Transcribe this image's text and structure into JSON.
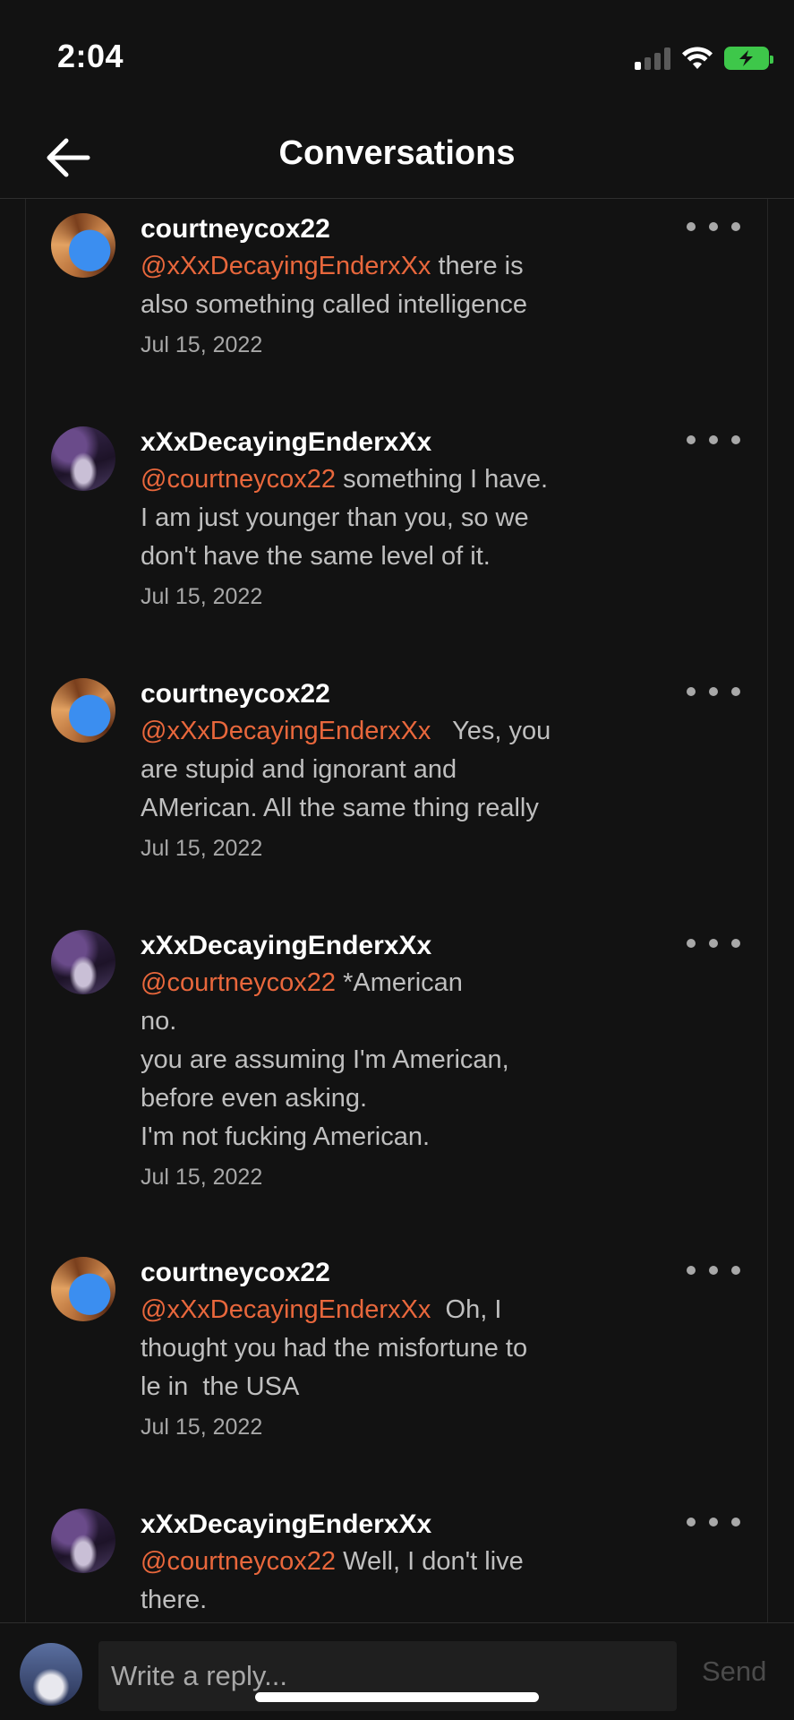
{
  "status_bar": {
    "time": "2:04"
  },
  "header": {
    "title": "Conversations"
  },
  "comments": [
    {
      "author": "courtneycox22",
      "mention": "@xXxDecayingEnderxXx",
      "text": " there is\nalso something called intelligence",
      "date": "Jul 15, 2022"
    },
    {
      "author": "xXxDecayingEnderxXx",
      "mention": "@courtneycox22",
      "text": " something I have.\nI am just younger than you, so we\ndon't have the same level of it.",
      "date": "Jul 15, 2022"
    },
    {
      "author": "courtneycox22",
      "mention": "@xXxDecayingEnderxXx",
      "text": "   Yes, you\nare stupid and ignorant and\nAMerican. All the same thing really",
      "date": "Jul 15, 2022"
    },
    {
      "author": "xXxDecayingEnderxXx",
      "mention": "@courtneycox22",
      "text": " *American\nno.\nyou are assuming I'm American,\nbefore even asking.\nI'm not fucking American.",
      "date": "Jul 15, 2022"
    },
    {
      "author": "courtneycox22",
      "mention": "@xXxDecayingEnderxXx",
      "text": "  Oh, I\nthought you had the misfortune to\nle in  the USA",
      "date": "Jul 15, 2022"
    },
    {
      "author": "xXxDecayingEnderxXx",
      "mention": "@courtneycox22",
      "text": " Well, I don't live\nthere.",
      "date": ""
    }
  ],
  "reply": {
    "placeholder": "Write a reply...",
    "send_label": "Send"
  },
  "colors": {
    "background": "#121212",
    "mention": "#e8673c",
    "battery": "#3ec74a"
  },
  "icons": {
    "back": "arrow-left-icon",
    "more": "more-horizontal-icon",
    "wifi": "wifi-icon",
    "signal": "cellular-signal-icon",
    "battery": "battery-charging-icon"
  }
}
